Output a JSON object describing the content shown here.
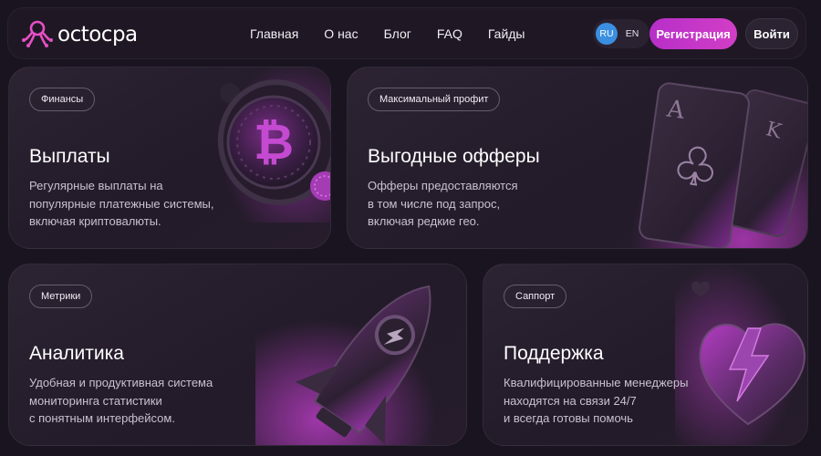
{
  "header": {
    "logo_text": "octocpa",
    "nav": [
      "Главная",
      "О нас",
      "Блог",
      "FAQ",
      "Гайды"
    ],
    "languages": [
      "RU",
      "EN"
    ],
    "active_language": "RU",
    "register_label": "Регистрация",
    "login_label": "Войти"
  },
  "cards": [
    {
      "tag": "Финансы",
      "title": "Выплаты",
      "desc": [
        "Регулярные выплаты на",
        "популярные платежные системы,",
        "включая криптовалюты."
      ],
      "icon": "bitcoin-coin-icon"
    },
    {
      "tag": "Максимальный профит",
      "title": "Выгодные офферы",
      "desc": [
        "Офферы предоставляются",
        "в том числе под запрос,",
        "включая редкие гео."
      ],
      "icon": "playing-cards-icon"
    },
    {
      "tag": "Метрики",
      "title": "Аналитика",
      "desc": [
        "Удобная и продуктивная система",
        "мониторинга статистики",
        "с понятным интерфейсом."
      ],
      "icon": "rocket-icon"
    },
    {
      "tag": "Саппорт",
      "title": "Поддержка",
      "desc": [
        "Квалифицированные менеджеры",
        "находятся на связи 24/7",
        "и всегда готовы помочь"
      ],
      "icon": "heart-lightning-icon"
    }
  ],
  "colors": {
    "background": "#1a1420",
    "accent": "#c235c8",
    "active_lang": "#3a8fe0"
  }
}
